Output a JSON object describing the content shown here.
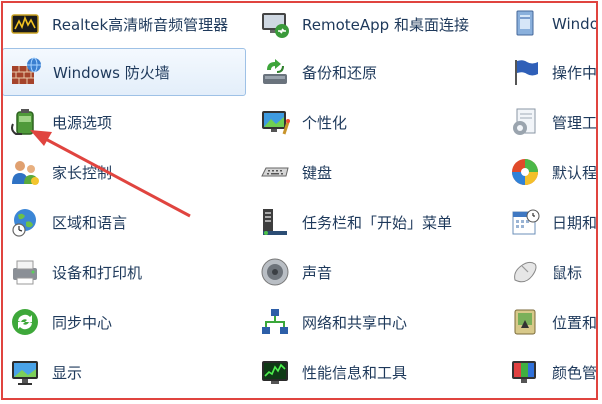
{
  "accent_colors": {
    "link": "#1e395b",
    "highlight_border": "#e0443f",
    "selection": "#cfe3f7"
  },
  "columns": [
    {
      "items": [
        {
          "label": "Realtek高清晰音频管理器",
          "icon": "realtek-audio-icon"
        },
        {
          "label": "Windows 防火墙",
          "icon": "firewall-icon",
          "selected": true
        },
        {
          "label": "电源选项",
          "icon": "power-options-icon"
        },
        {
          "label": "家长控制",
          "icon": "parental-controls-icon"
        },
        {
          "label": "区域和语言",
          "icon": "region-language-icon"
        },
        {
          "label": "设备和打印机",
          "icon": "devices-printers-icon"
        },
        {
          "label": "同步中心",
          "icon": "sync-center-icon"
        },
        {
          "label": "显示",
          "icon": "display-icon"
        }
      ]
    },
    {
      "items": [
        {
          "label": "RemoteApp 和桌面连接",
          "icon": "remoteapp-icon"
        },
        {
          "label": "备份和还原",
          "icon": "backup-restore-icon"
        },
        {
          "label": "个性化",
          "icon": "personalization-icon"
        },
        {
          "label": "键盘",
          "icon": "keyboard-icon"
        },
        {
          "label": "任务栏和「开始」菜单",
          "icon": "taskbar-start-icon"
        },
        {
          "label": "声音",
          "icon": "sound-icon"
        },
        {
          "label": "网络和共享中心",
          "icon": "network-sharing-icon"
        },
        {
          "label": "性能信息和工具",
          "icon": "performance-icon"
        }
      ]
    },
    {
      "items": [
        {
          "label": "Windo",
          "icon": "windows-cardspace-icon"
        },
        {
          "label": "操作中",
          "icon": "action-center-icon"
        },
        {
          "label": "管理工",
          "icon": "admin-tools-icon"
        },
        {
          "label": "默认程",
          "icon": "default-programs-icon"
        },
        {
          "label": "日期和",
          "icon": "date-time-icon"
        },
        {
          "label": "鼠标",
          "icon": "mouse-icon"
        },
        {
          "label": "位置和",
          "icon": "location-sensors-icon"
        },
        {
          "label": "颜色管",
          "icon": "color-management-icon"
        }
      ]
    }
  ]
}
